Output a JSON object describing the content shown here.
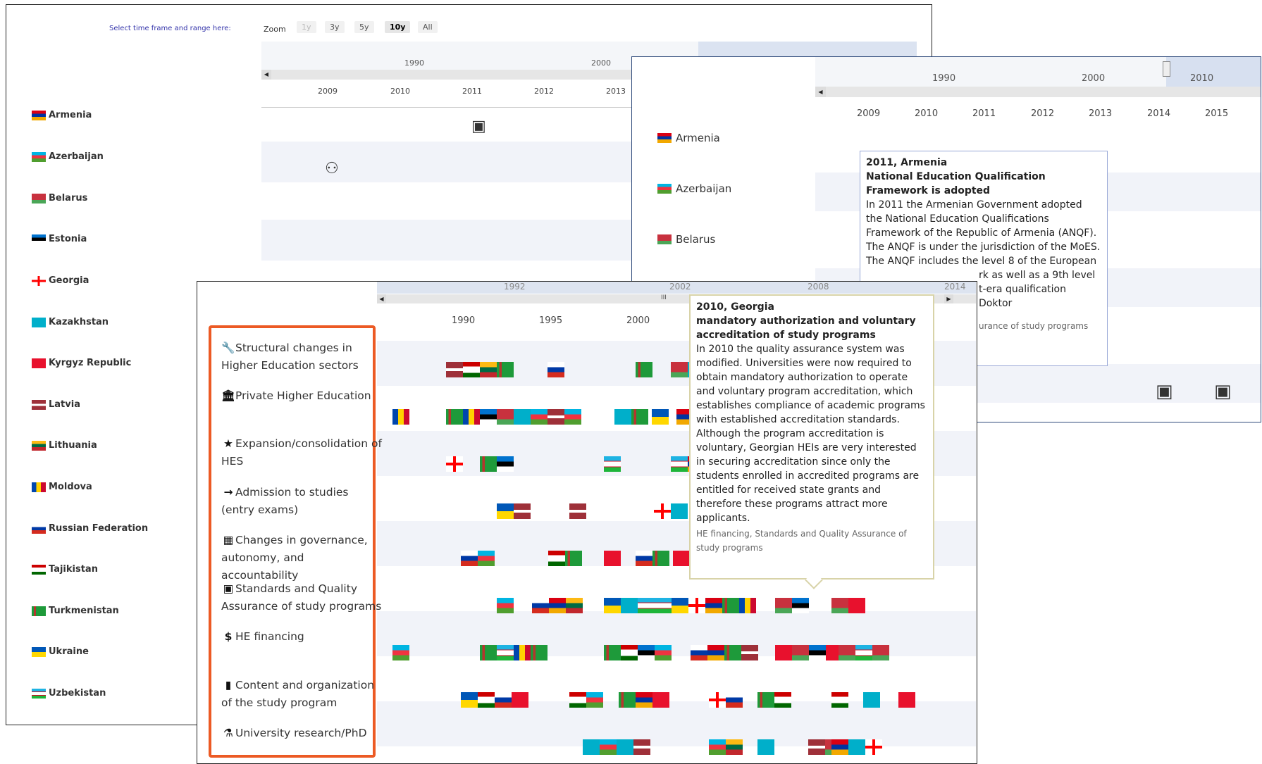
{
  "panel_a": {
    "selector_label": "Select time frame and range here:",
    "zoom_label": "Zoom",
    "zoom_buttons": [
      "1y",
      "3y",
      "5y",
      "10y",
      "All"
    ],
    "navigator_labels": [
      "1990",
      "2000"
    ],
    "axis_years": [
      "2009",
      "2010",
      "2011",
      "2012",
      "2013"
    ],
    "countries": [
      "Armenia",
      "Azerbaijan",
      "Belarus",
      "Estonia",
      "Georgia",
      "Kazakhstan",
      "Kyrgyz Republic",
      "Latvia",
      "Lithuania",
      "Moldova",
      "Russian Federation",
      "Tajikistan",
      "Turkmenistan",
      "Ukraine",
      "Uzbekistan"
    ],
    "icons": [
      "standards-icon",
      "governance-icon",
      "private-he-icon"
    ]
  },
  "panel_b": {
    "navigator_labels": [
      "1990",
      "2000",
      "2010"
    ],
    "axis_years": [
      "2009",
      "2010",
      "2011",
      "2012",
      "2013",
      "2014",
      "2015"
    ],
    "countries": [
      "Armenia",
      "Azerbaijan",
      "Belarus"
    ],
    "tooltip": {
      "heading": "2011, Armenia",
      "title": "National Education Qualification Framework is adopted",
      "body": "In 2011 the Armenian Government adopted the National Education Qualifications Framework of the Republic of Armenia (ANQF). The ANQF is under the jurisdiction of the MoES. The ANQF includes the level 8 of the European",
      "body_cont": "rk as well as a 9th level",
      "body_cont2": "t-era qualification Doktor",
      "tags": "urance of study programs"
    }
  },
  "panel_c": {
    "navigator_labels": [
      "1992",
      "2002",
      "2008",
      "2014"
    ],
    "scroll_grip": "III",
    "axis_years": [
      "1990",
      "1995",
      "2000"
    ],
    "categories": [
      {
        "icon": "wrench-icon",
        "glyph": "🔧",
        "label": "Structural changes in Higher Education sectors"
      },
      {
        "icon": "institution-icon",
        "glyph": "🏛",
        "label": "Private Higher Education"
      },
      {
        "icon": "star-icon",
        "glyph": "★",
        "label": "Expansion/consolidation of HES"
      },
      {
        "icon": "sign-in-icon",
        "glyph": "→",
        "label": "Admission to studies (entry exams)"
      },
      {
        "icon": "grid-icon",
        "glyph": "▦",
        "label": "Changes in governance, autonomy, and accountability"
      },
      {
        "icon": "certificate-icon",
        "glyph": "▣",
        "label": "Standards and Quality Assurance of study programs"
      },
      {
        "icon": "money-icon",
        "glyph": "$",
        "label": "HE financing"
      },
      {
        "icon": "book-icon",
        "glyph": "▮",
        "label": "Content and organization of the study program"
      },
      {
        "icon": "flask-icon",
        "glyph": "⚗",
        "label": "University research/PhD"
      }
    ],
    "tooltip": {
      "heading": "2010, Georgia",
      "title": "mandatory authorization and voluntary accreditation of study programs",
      "body": "In 2010 the quality assurance system was modified. Universities were now required to obtain mandatory authorization to operate and voluntary program accreditation, which establishes compliance of academic programs with established accreditation standards. Although the program accreditation is voluntary, Georgian HEIs are very interested in securing accreditation since only the students enrolled in accredited programs are entitled for received state grants and therefore these programs attract more applicants.",
      "tags": "HE financing, Standards and Quality Assurance of study programs"
    }
  },
  "colors": {
    "legend_border": "#ec5a24",
    "navigator_selection": "#dbe3f1",
    "row_band": "#f1f3f9",
    "tooltip_b_border": "#98a7d6",
    "tooltip_c_border": "#d8d3a8"
  }
}
